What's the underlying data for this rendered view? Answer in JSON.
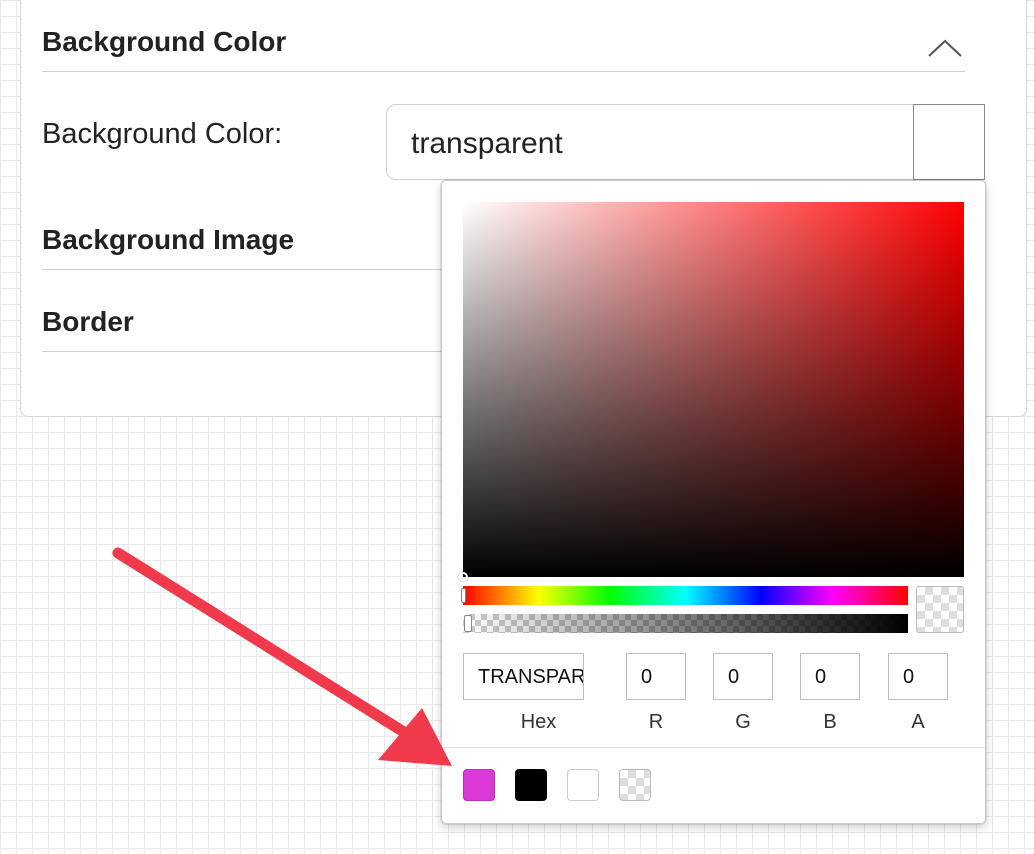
{
  "panel": {
    "sections": [
      {
        "title": "Background Color",
        "expanded": true
      },
      {
        "title": "Background Image",
        "expanded": false
      },
      {
        "title": "Border",
        "expanded": false
      }
    ],
    "background_color_label": "Background Color:",
    "background_color_value": "transparent"
  },
  "picker": {
    "hex_value": "TRANSPARENT",
    "r": "0",
    "g": "0",
    "b": "0",
    "a": "0",
    "labels": {
      "hex": "Hex",
      "r": "R",
      "g": "G",
      "b": "B",
      "a": "A"
    },
    "hue_base_color": "#ff0000",
    "presets": [
      {
        "name": "magenta",
        "color": "#dc3ad8"
      },
      {
        "name": "black",
        "color": "#000000"
      },
      {
        "name": "white",
        "color": "#ffffff"
      },
      {
        "name": "transparent",
        "color": "transparent"
      }
    ]
  },
  "annotation": {
    "arrow_color": "#f03a4c"
  }
}
